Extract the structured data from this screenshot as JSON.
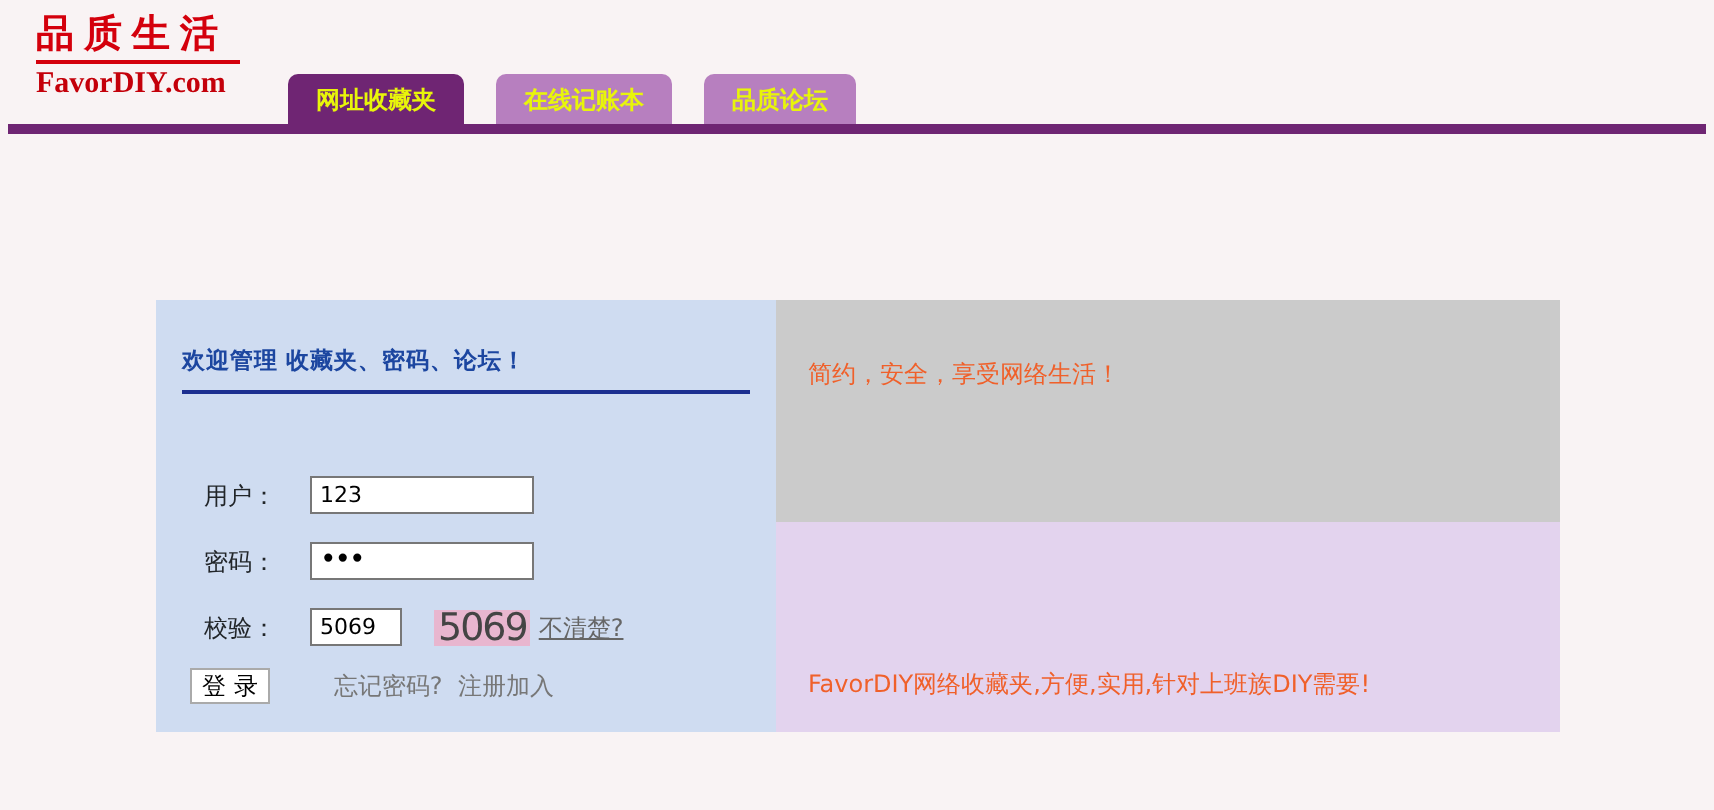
{
  "logo": {
    "title": "品质生活",
    "domain": "FavorDIY.com"
  },
  "tabs": [
    {
      "label": "网址收藏夹",
      "selected": true
    },
    {
      "label": "在线记账本",
      "selected": false
    },
    {
      "label": "品质论坛",
      "selected": false
    }
  ],
  "login": {
    "heading": "欢迎管理  收藏夹、密码、论坛！",
    "fields": [
      {
        "label": "用户：",
        "value": "123",
        "kind": "text"
      },
      {
        "label": "密码：",
        "value": "•••",
        "kind": "password"
      },
      {
        "label": "校验：",
        "value": "5069",
        "kind": "captcha",
        "captcha": "5069",
        "refresh_link": "不清楚?"
      }
    ],
    "submit": "登 录",
    "links": [
      "忘记密码?",
      "注册加入"
    ]
  },
  "slogans": [
    "简约，安全，享受网络生活！",
    "FavorDIY网络收藏夹,方便,实用,针对上班族DIY需要!"
  ]
}
